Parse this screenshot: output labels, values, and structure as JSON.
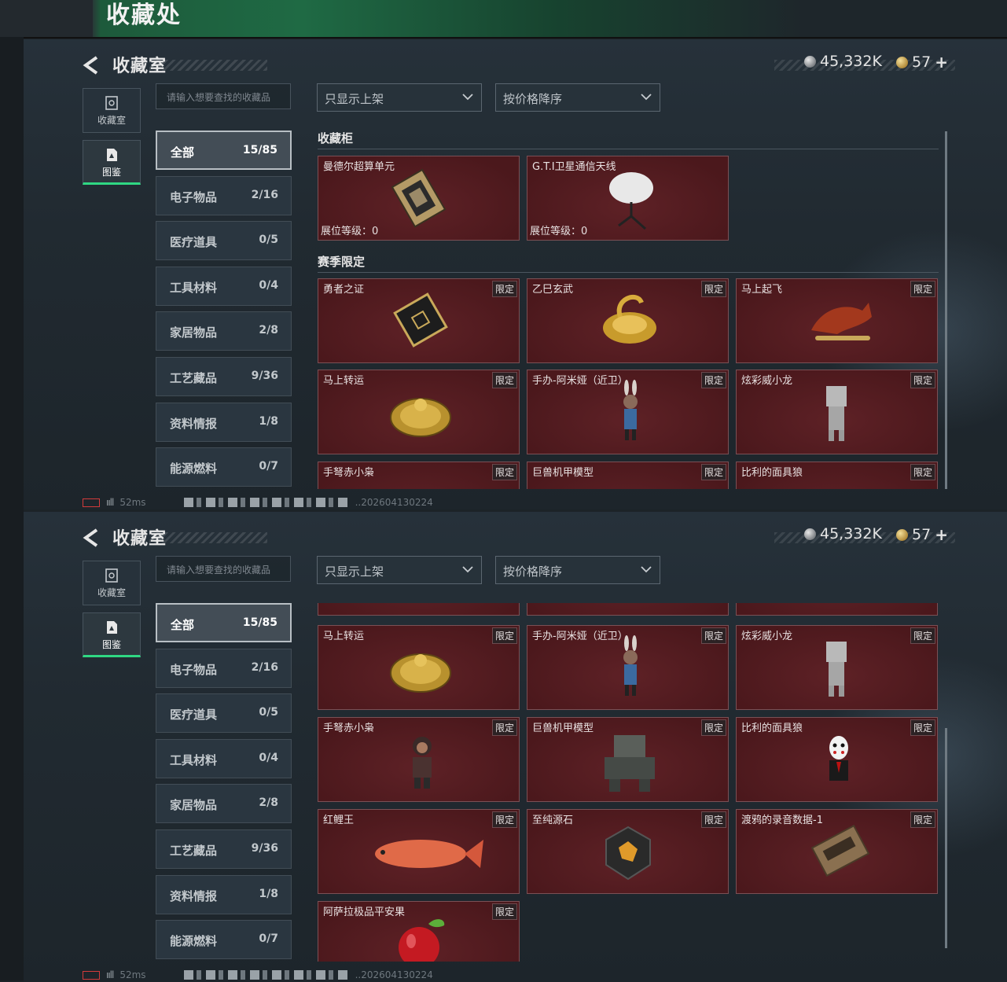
{
  "banner": {
    "title": "收藏处"
  },
  "panels": [
    {
      "header": {
        "title": "收藏室"
      },
      "currency": {
        "silver": "45,332K",
        "gold": "57"
      },
      "nav": [
        {
          "label": "收藏室",
          "icon": "cabinet-icon"
        },
        {
          "label": "图鉴",
          "icon": "codex-icon"
        }
      ],
      "search": {
        "placeholder": "请输入想要查找的收藏品"
      },
      "filters": {
        "shelf": "只显示上架",
        "sort": "按价格降序"
      },
      "categories": [
        {
          "label": "全部",
          "count": "15/85"
        },
        {
          "label": "电子物品",
          "count": "2/16"
        },
        {
          "label": "医疗道具",
          "count": "0/5"
        },
        {
          "label": "工具材料",
          "count": "0/4"
        },
        {
          "label": "家居物品",
          "count": "2/8"
        },
        {
          "label": "工艺藏品",
          "count": "9/36"
        },
        {
          "label": "资料情报",
          "count": "1/8"
        },
        {
          "label": "能源燃料",
          "count": "0/7"
        }
      ],
      "sections": [
        {
          "title": "收藏柜"
        },
        {
          "title": "赛季限定"
        }
      ],
      "cabinet_items": [
        {
          "name": "曼德尔超算单元",
          "level": "展位等级：0"
        },
        {
          "name": "G.T.I卫星通信天线",
          "level": "展位等级：0"
        }
      ],
      "season_items": [
        {
          "name": "勇者之证",
          "tag": "限定"
        },
        {
          "name": "乙巳玄武",
          "tag": "限定"
        },
        {
          "name": "马上起飞",
          "tag": "限定"
        },
        {
          "name": "马上转运",
          "tag": "限定"
        },
        {
          "name": "手办-阿米娅（近卫）",
          "tag": "限定"
        },
        {
          "name": "炫彩威小龙",
          "tag": "限定"
        },
        {
          "name": "手弩赤小枭",
          "tag": "限定"
        },
        {
          "name": "巨兽机甲模型",
          "tag": "限定"
        },
        {
          "name": "比利的面具狼",
          "tag": "限定"
        }
      ],
      "status": {
        "ping": "52ms",
        "code": "..202604130224"
      }
    },
    {
      "header": {
        "title": "收藏室"
      },
      "currency": {
        "silver": "45,332K",
        "gold": "57"
      },
      "nav": [
        {
          "label": "收藏室",
          "icon": "cabinet-icon"
        },
        {
          "label": "图鉴",
          "icon": "codex-icon"
        }
      ],
      "search": {
        "placeholder": "请输入想要查找的收藏品"
      },
      "filters": {
        "shelf": "只显示上架",
        "sort": "按价格降序"
      },
      "categories": [
        {
          "label": "全部",
          "count": "15/85"
        },
        {
          "label": "电子物品",
          "count": "2/16"
        },
        {
          "label": "医疗道具",
          "count": "0/5"
        },
        {
          "label": "工具材料",
          "count": "0/4"
        },
        {
          "label": "家居物品",
          "count": "2/8"
        },
        {
          "label": "工艺藏品",
          "count": "9/36"
        },
        {
          "label": "资料情报",
          "count": "1/8"
        },
        {
          "label": "能源燃料",
          "count": "0/7"
        }
      ],
      "season_items": [
        {
          "name": "马上转运",
          "tag": "限定"
        },
        {
          "name": "手办-阿米娅（近卫）",
          "tag": "限定"
        },
        {
          "name": "炫彩威小龙",
          "tag": "限定"
        },
        {
          "name": "手弩赤小枭",
          "tag": "限定"
        },
        {
          "name": "巨兽机甲模型",
          "tag": "限定"
        },
        {
          "name": "比利的面具狼",
          "tag": "限定"
        },
        {
          "name": "红鲤王",
          "tag": "限定"
        },
        {
          "name": "至纯源石",
          "tag": "限定"
        },
        {
          "name": "渡鸦的录音数据-1",
          "tag": "限定"
        },
        {
          "name": "阿萨拉极品平安果",
          "tag": "限定"
        }
      ],
      "status": {
        "ping": "52ms",
        "code": "..202604130224"
      }
    }
  ],
  "colors": {
    "accent_green": "#2fd883",
    "card_red": "#531b1f",
    "panel_bg": "#212a31"
  }
}
